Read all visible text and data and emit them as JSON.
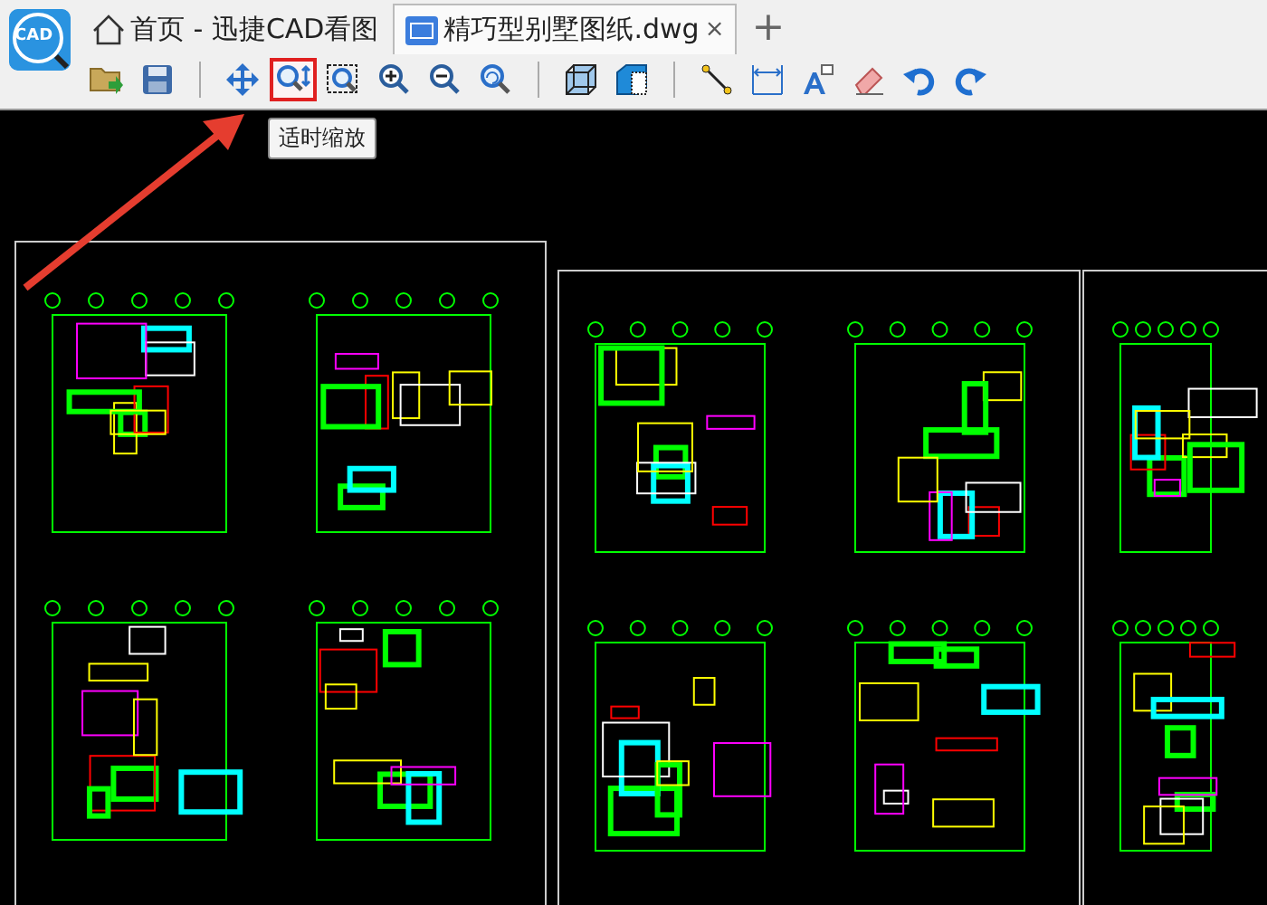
{
  "tabs": [
    {
      "kind": "home",
      "label": "首页 - 迅捷CAD看图",
      "selected": false
    },
    {
      "kind": "file",
      "label": "精巧型别墅图纸.dwg",
      "close": "×",
      "selected": true
    }
  ],
  "new_tab": "+",
  "toolbar": [
    {
      "kind": "open",
      "highlighted": false
    },
    {
      "kind": "save",
      "highlighted": false
    },
    {
      "kind": "sep"
    },
    {
      "kind": "pan",
      "highlighted": false
    },
    {
      "kind": "fit",
      "highlighted": true
    },
    {
      "kind": "window",
      "highlighted": false
    },
    {
      "kind": "zoomin",
      "highlighted": false
    },
    {
      "kind": "zoomout",
      "highlighted": false
    },
    {
      "kind": "zoomprev",
      "highlighted": false
    },
    {
      "kind": "sep"
    },
    {
      "kind": "wire",
      "highlighted": false
    },
    {
      "kind": "solid",
      "highlighted": false
    },
    {
      "kind": "sep"
    },
    {
      "kind": "line",
      "highlighted": false
    },
    {
      "kind": "dim",
      "highlighted": false
    },
    {
      "kind": "text",
      "highlighted": false
    },
    {
      "kind": "eraser",
      "highlighted": false
    },
    {
      "kind": "undo",
      "highlighted": false
    },
    {
      "kind": "redo",
      "highlighted": false
    }
  ],
  "tooltip": "适时缩放",
  "logo": "CAD"
}
